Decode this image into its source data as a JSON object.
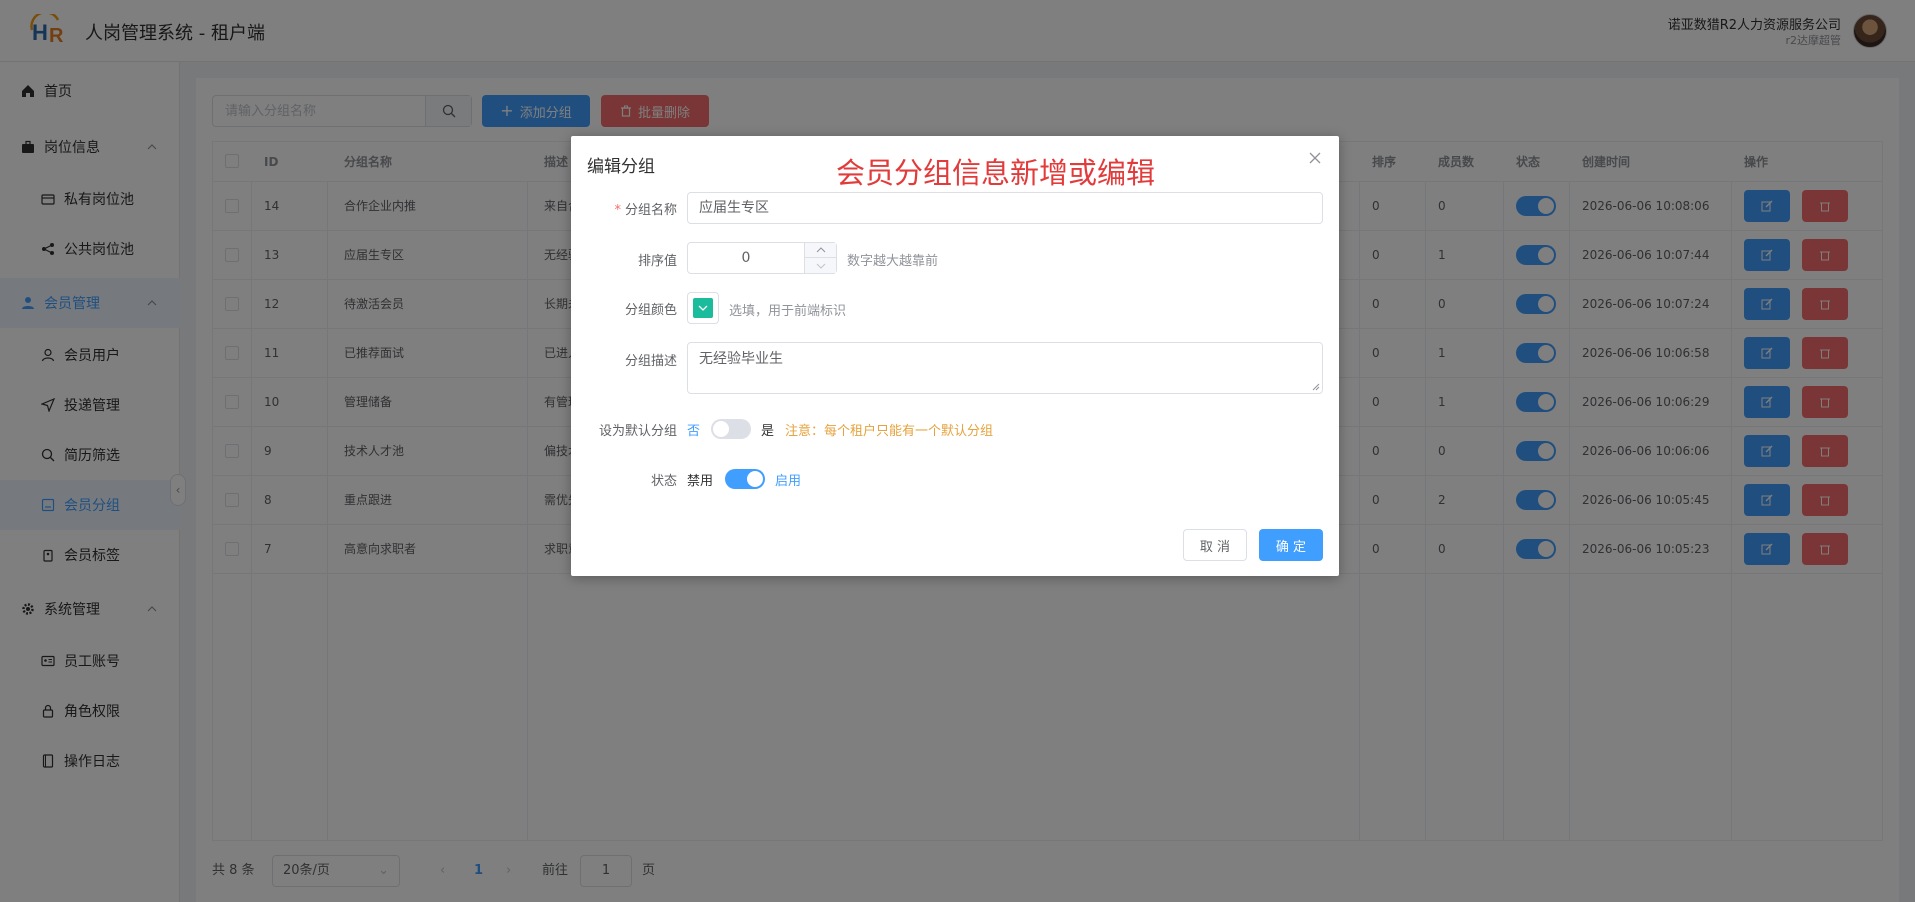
{
  "header": {
    "title": "人岗管理系统 - 租户端",
    "company": "诺亚数猎R2人力资源服务公司",
    "role": "r2达摩超管"
  },
  "sidebar": {
    "items": [
      {
        "label": "首页",
        "icon": "home-icon"
      },
      {
        "label": "岗位信息",
        "icon": "briefcase-icon"
      },
      {
        "label": "私有岗位池",
        "icon": "folder-icon"
      },
      {
        "label": "公共岗位池",
        "icon": "share-icon"
      },
      {
        "label": "会员管理",
        "icon": "user-icon"
      },
      {
        "label": "会员用户",
        "icon": "user-outline-icon"
      },
      {
        "label": "投递管理",
        "icon": "send-icon"
      },
      {
        "label": "简历筛选",
        "icon": "search-icon"
      },
      {
        "label": "会员分组",
        "icon": "group-icon"
      },
      {
        "label": "会员标签",
        "icon": "tag-icon"
      },
      {
        "label": "系统管理",
        "icon": "gear-icon"
      },
      {
        "label": "员工账号",
        "icon": "id-card-icon"
      },
      {
        "label": "角色权限",
        "icon": "lock-icon"
      },
      {
        "label": "操作日志",
        "icon": "notebook-icon"
      }
    ]
  },
  "toolbar": {
    "search_placeholder": "请输入分组名称",
    "add_label": "添加分组",
    "batch_delete_label": "批量删除"
  },
  "table": {
    "columns": [
      "ID",
      "分组名称",
      "描述",
      "排序",
      "成员数",
      "状态",
      "创建时间",
      "操作"
    ],
    "rows": [
      {
        "id": "14",
        "name": "合作企业内推",
        "desc": "来自合",
        "sort": "0",
        "members": "0",
        "status": true,
        "created": "2026-06-06 10:08:06"
      },
      {
        "id": "13",
        "name": "应届生专区",
        "desc": "无经验",
        "sort": "0",
        "members": "1",
        "status": true,
        "created": "2026-06-06 10:07:44"
      },
      {
        "id": "12",
        "name": "待激活会员",
        "desc": "长期未",
        "sort": "0",
        "members": "0",
        "status": true,
        "created": "2026-06-06 10:07:24"
      },
      {
        "id": "11",
        "name": "已推荐面试",
        "desc": "已进入",
        "sort": "0",
        "members": "1",
        "status": true,
        "created": "2026-06-06 10:06:58"
      },
      {
        "id": "10",
        "name": "管理储备",
        "desc": "有管理",
        "sort": "0",
        "members": "1",
        "status": true,
        "created": "2026-06-06 10:06:29"
      },
      {
        "id": "9",
        "name": "技术人才池",
        "desc": "偏技术",
        "sort": "0",
        "members": "0",
        "status": true,
        "created": "2026-06-06 10:06:06"
      },
      {
        "id": "8",
        "name": "重点跟进",
        "desc": "需优先",
        "sort": "0",
        "members": "2",
        "status": true,
        "created": "2026-06-06 10:05:45"
      },
      {
        "id": "7",
        "name": "高意向求职者",
        "desc": "求职意",
        "sort": "0",
        "members": "0",
        "status": true,
        "created": "2026-06-06 10:05:23"
      }
    ]
  },
  "pagination": {
    "total": "共 8 条",
    "page_size": "20条/页",
    "current": "1",
    "goto_label": "前往",
    "goto_value": "1",
    "page_unit": "页"
  },
  "dialog": {
    "title": "编辑分组",
    "banner": "会员分组信息新增或编辑",
    "name_label": "分组名称",
    "name_value": "应届生专区",
    "sort_label": "排序值",
    "sort_value": "0",
    "sort_hint": "数字越大越靠前",
    "color_label": "分组颜色",
    "color_value": "#1abc9c",
    "color_hint": "选填，用于前端标识",
    "desc_label": "分组描述",
    "desc_value": "无经验毕业生",
    "default_label": "设为默认分组",
    "default_off": "否",
    "default_on": "是",
    "default_note": "注意：每个租户只能有一个默认分组",
    "default_enabled": false,
    "status_label": "状态",
    "status_off": "禁用",
    "status_on": "启用",
    "status_enabled": true,
    "cancel_label": "取 消",
    "ok_label": "确 定"
  },
  "colors": {
    "primary": "#409eff",
    "danger": "#f56c6c",
    "warning": "#e6a23c",
    "banner": "#e23b3b"
  }
}
